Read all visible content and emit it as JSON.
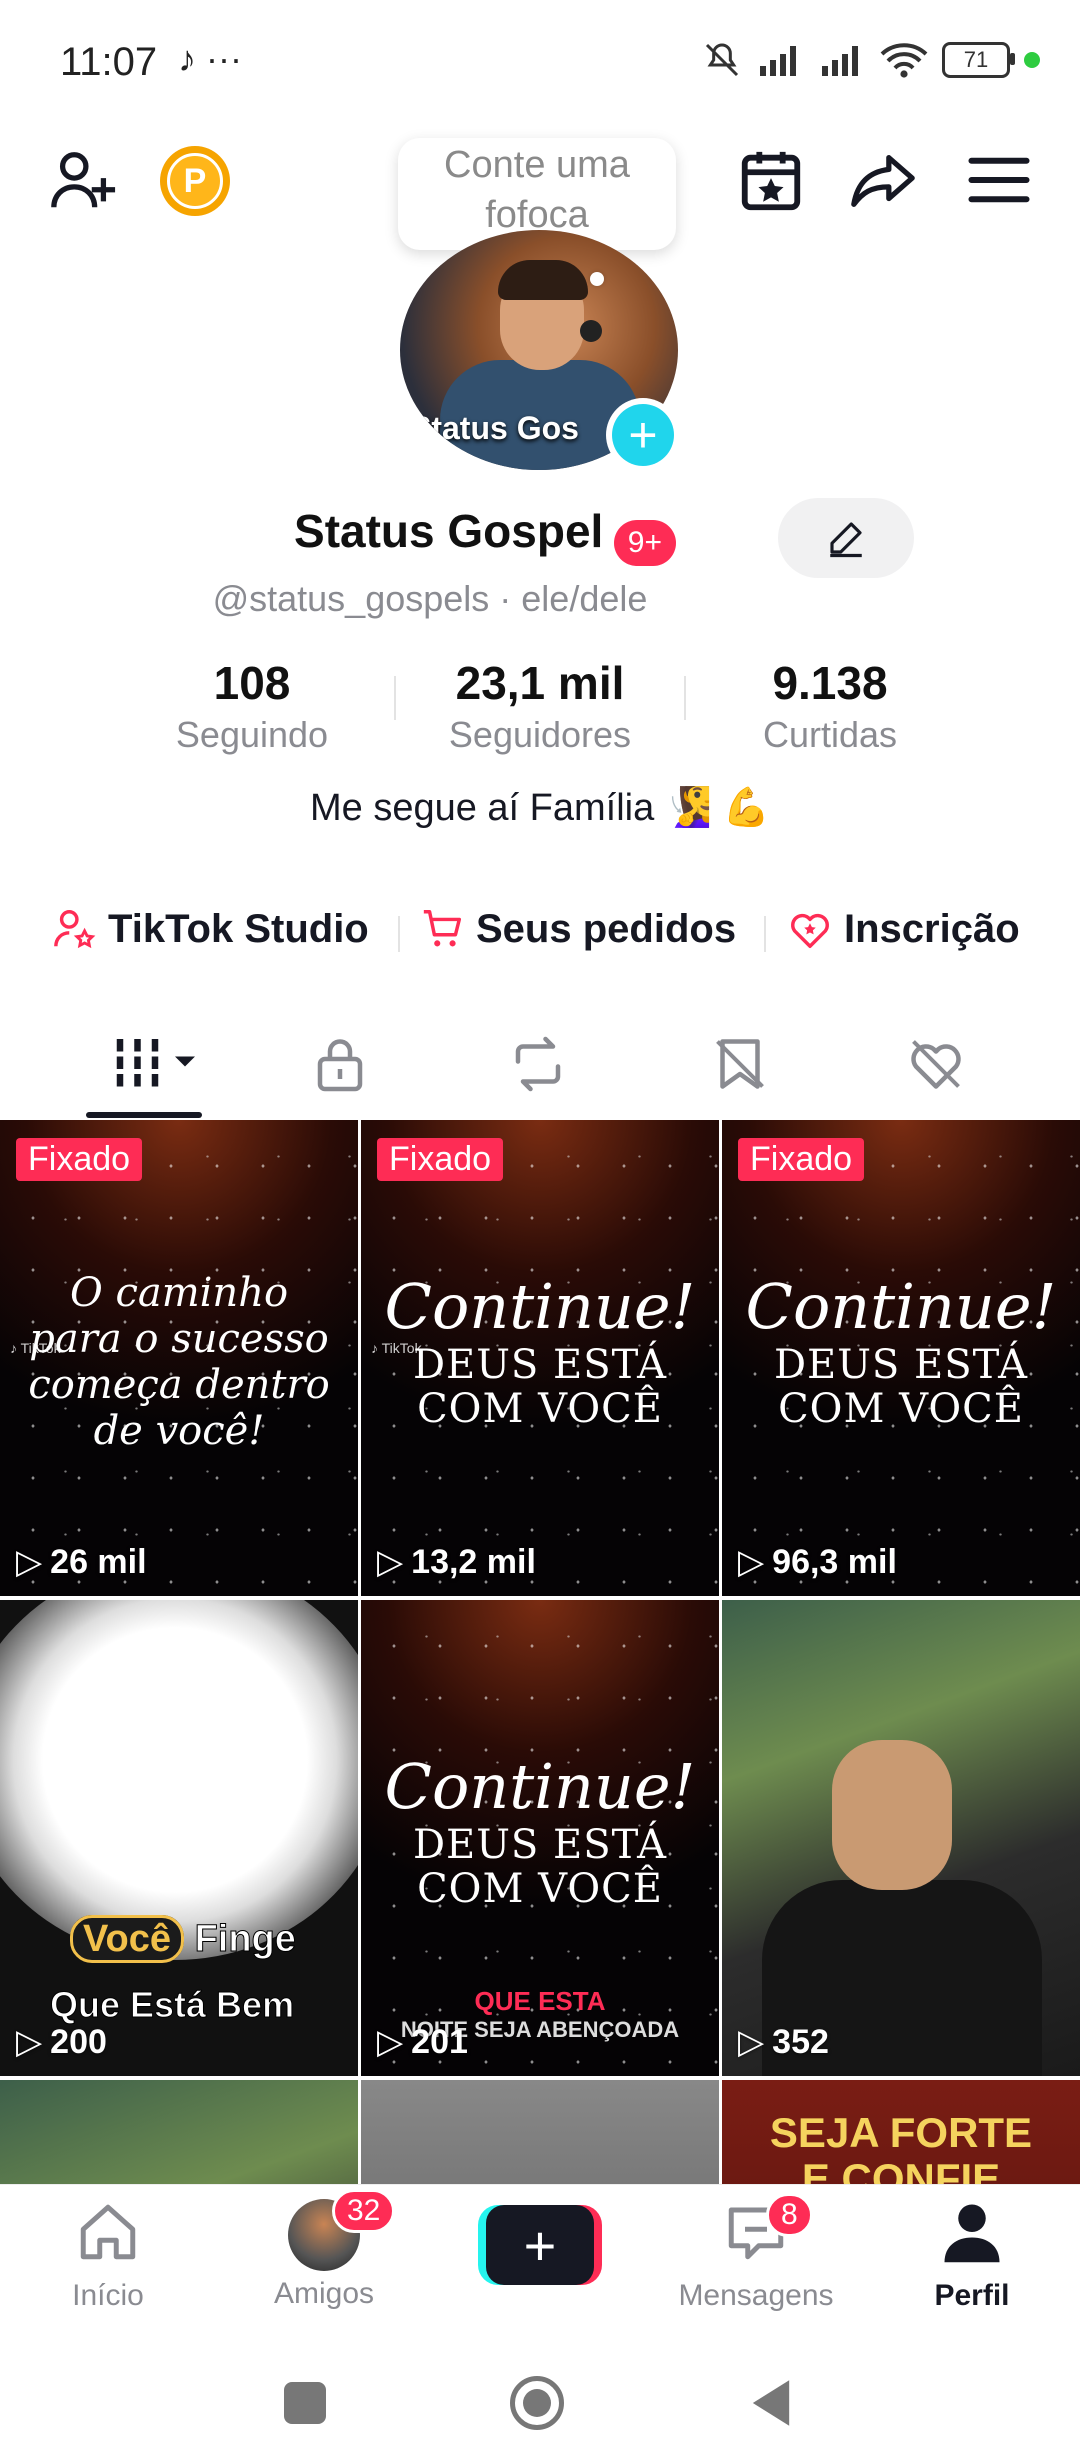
{
  "status_bar": {
    "time": "11:07",
    "notif_icons": "♪ ···",
    "battery": "71"
  },
  "header": {
    "bubble_line1": "Conte uma",
    "bubble_line2": "fofoca",
    "avatar_caption": "Status Gos"
  },
  "profile": {
    "name": "Status Gospel",
    "badge": "9+",
    "handle": "@status_gospels · ele/dele",
    "bio": "Me segue aí Família 🧏‍♀️ 💪",
    "stats": [
      {
        "value": "108",
        "label": "Seguindo"
      },
      {
        "value": "23,1 mil",
        "label": "Seguidores"
      },
      {
        "value": "9.138",
        "label": "Curtidas"
      }
    ]
  },
  "links": [
    {
      "label": "TikTok Studio",
      "icon": "person-star-icon"
    },
    {
      "label": "Seus pedidos",
      "icon": "cart-icon"
    },
    {
      "label": "Inscrição",
      "icon": "heart-star-icon"
    }
  ],
  "tabs": [
    "videos-grid-icon",
    "lock-icon",
    "repost-icon",
    "bookmark-icon",
    "liked-icon"
  ],
  "grid": [
    {
      "pinned": "Fixado",
      "views": "26 mil",
      "text": [
        "O caminho",
        "para o sucesso",
        "começa dentro",
        "de você!"
      ]
    },
    {
      "pinned": "Fixado",
      "views": "13,2 mil",
      "text": [
        "Continue!",
        "DEUS ESTÁ",
        "COM VOCÊ"
      ]
    },
    {
      "pinned": "Fixado",
      "views": "96,3 mil",
      "text": [
        "Continue!",
        "DEUS ESTÁ",
        "COM VOCÊ"
      ]
    },
    {
      "views": "200",
      "text": [
        "Você",
        "Finge",
        "Que Está Bem"
      ]
    },
    {
      "views": "201",
      "text": [
        "Continue!",
        "DEUS ESTÁ",
        "COM VOCÊ",
        "QUE ESTA",
        "NOITE SEJA ABENÇOADA"
      ]
    },
    {
      "views": "352"
    },
    {
      "text": [
        "SEJA FORTE",
        "E CONFIE"
      ]
    }
  ],
  "nav": {
    "items": [
      {
        "label": "Início"
      },
      {
        "label": "Amigos",
        "badge": "32"
      },
      {
        "label": ""
      },
      {
        "label": "Mensagens",
        "badge": "8"
      },
      {
        "label": "Perfil"
      }
    ]
  },
  "colors": {
    "accent": "#fe2c55",
    "cyan": "#20d5ec",
    "text": "#161823",
    "muted": "#8a8b91"
  }
}
